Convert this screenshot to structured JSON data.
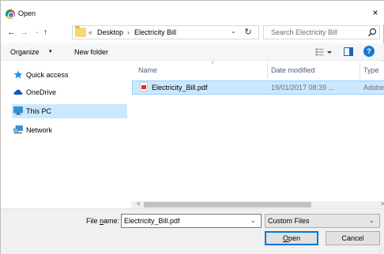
{
  "window": {
    "title": "Open",
    "close_glyph": "×"
  },
  "nav": {
    "back_glyph": "←",
    "forward_glyph": "→",
    "recent_glyph": "⌄",
    "up_glyph": "↑",
    "address": {
      "overflow": "«",
      "crumbs": [
        "Desktop",
        "Electricity Bill"
      ],
      "separator": "›",
      "dropdown_glyph": "⌄",
      "refresh_glyph": "↻"
    },
    "search": {
      "placeholder": "Search Electricity Bill",
      "icon": "search-icon"
    }
  },
  "toolbar": {
    "organize_label": "Organize",
    "organize_arrow": "▾",
    "new_folder_label": "New folder",
    "help_glyph": "?"
  },
  "nav_pane": {
    "items": [
      {
        "label": "Quick access",
        "icon": "star-icon",
        "color": "#1e90e6"
      },
      {
        "label": "OneDrive",
        "icon": "cloud-icon",
        "color": "#0b5fb5"
      },
      {
        "label": "This PC",
        "icon": "monitor-icon",
        "color": "#2b95e0",
        "selected": true
      },
      {
        "label": "Network",
        "icon": "network-icon",
        "color": "#2b95e0"
      }
    ]
  },
  "content": {
    "sort_glyph": "˅",
    "columns": [
      "Name",
      "Date modified",
      "Type"
    ],
    "files": [
      {
        "name": "Electricity_Bill.pdf",
        "date": "19/01/2017 08:39 ...",
        "type": "Adobe",
        "icon": "pdf-icon",
        "selected": true
      }
    ],
    "scroll_left_glyph": "<",
    "scroll_right_glyph": ">"
  },
  "footer": {
    "file_name_label_prefix": "File ",
    "file_name_label_access": "n",
    "file_name_label_suffix": "ame:",
    "file_name_value": "Electricity_Bill.pdf",
    "file_name_drop": "⌄",
    "file_type_value": "Custom Files",
    "file_type_drop": "⌄",
    "open_access": "O",
    "open_rest": "pen",
    "cancel_label": "Cancel",
    "grip": "⋰"
  },
  "colors": {
    "accent": "#0078d7",
    "selection": "#cce8ff",
    "help": "#1978d4",
    "pdf_red": "#d9312b"
  }
}
